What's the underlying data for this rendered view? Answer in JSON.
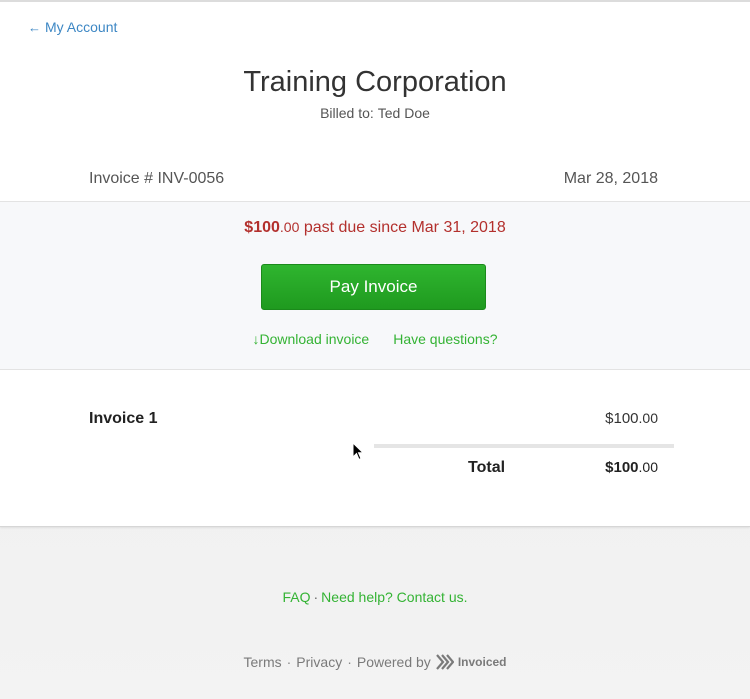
{
  "header": {
    "back_link": "My Account",
    "company": "Training Corporation",
    "billed_label": "Billed to:",
    "billed_name": "Ted Doe"
  },
  "invoice": {
    "number": "Invoice # INV-0056",
    "date": "Mar 28, 2018"
  },
  "due": {
    "currency": "$",
    "amount_main": "100",
    "amount_cents": ".00",
    "text": "past due since Mar 31, 2018",
    "pay_button": "Pay Invoice",
    "download_link": "Download invoice",
    "questions_link": "Have questions?"
  },
  "items": [
    {
      "name": "Invoice 1",
      "currency": "$",
      "amount_main": "100",
      "amount_cents": ".00"
    }
  ],
  "total": {
    "label": "Total",
    "currency": "$",
    "amount_main": "100",
    "amount_cents": ".00"
  },
  "footer": {
    "faq": "FAQ",
    "help": "Need help? Contact us.",
    "terms": "Terms",
    "privacy": "Privacy",
    "powered_by": "Powered by",
    "brand": "Invoiced"
  },
  "colors": {
    "link_blue": "#3d87c4",
    "accent_green": "#34b334",
    "pay_button": "#2fb52f",
    "due_red": "#b3302d"
  }
}
